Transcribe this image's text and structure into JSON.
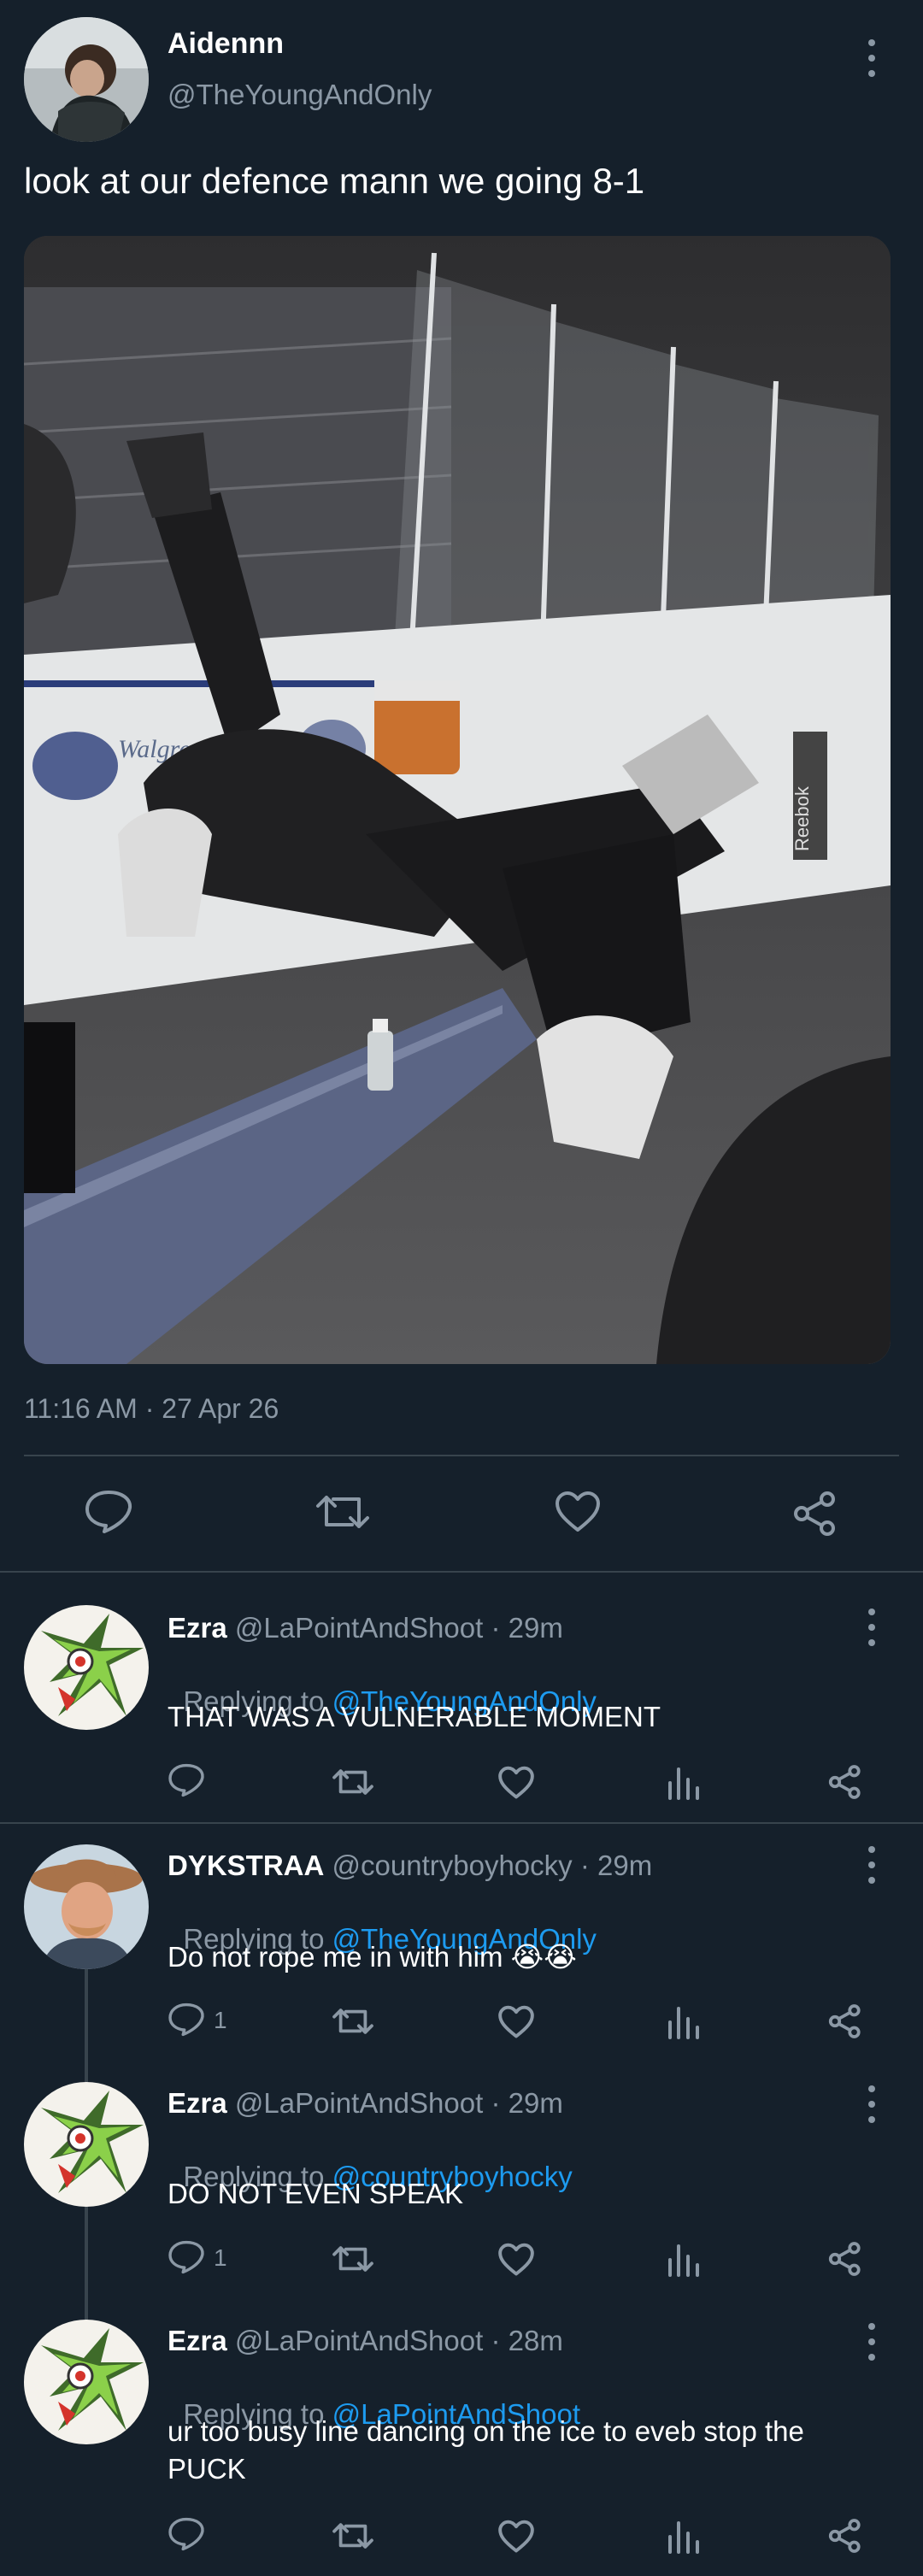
{
  "main_tweet": {
    "author_name": "Aidennn",
    "author_handle": "@TheYoungAndOnly",
    "text": "look at our defence mann we going 8-1",
    "timestamp": "11:16 AM · 27 Apr 26",
    "media_watermark_text": "Walgreens",
    "media_board_text": "Reebok"
  },
  "replies": [
    {
      "name": "Ezra",
      "handle": "@LaPointAndShoot",
      "time": "· 29m",
      "replying_prefix": "Replying to ",
      "replying_to": "@TheYoungAndOnly",
      "text": "THAT WAS A VULNERABLE MOMENT",
      "reply_count": ""
    },
    {
      "name": "DYKSTRAA",
      "handle": "@countryboyhocky",
      "time": "· 29m",
      "replying_prefix": "Replying to ",
      "replying_to": "@TheYoungAndOnly",
      "text": "Do not rope me in with him 😭😭",
      "reply_count": "1"
    },
    {
      "name": "Ezra",
      "handle": "@LaPointAndShoot",
      "time": "· 29m",
      "replying_prefix": "Replying to ",
      "replying_to": "@countryboyhocky",
      "text": "DO NOT EVEN SPEAK",
      "reply_count": "1"
    },
    {
      "name": "Ezra",
      "handle": "@LaPointAndShoot",
      "time": "· 28m",
      "replying_prefix": "Replying to ",
      "replying_to": "@LaPointAndShoot",
      "text_line1": "ur too busy line dancing on the ice to eveb stop the",
      "text_line2": "PUCK",
      "reply_count": ""
    }
  ],
  "colors": {
    "background": "#15202b",
    "muted": "#8b98a5",
    "link": "#1d9bf0",
    "divider": "#38444d"
  },
  "icons": {
    "reply": "speech-bubble-icon",
    "retweet": "retweet-icon",
    "like": "heart-icon",
    "views": "bar-chart-icon",
    "share": "share-icon",
    "menu": "vertical-dots-icon"
  }
}
